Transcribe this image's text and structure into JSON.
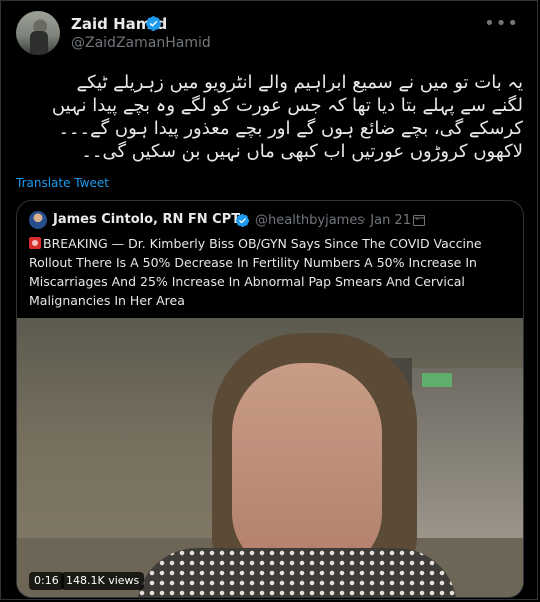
{
  "tweet": {
    "author_name": "Zaid Hamid",
    "author_handle": "@ZaidZamanHamid",
    "more_icon": "ellipsis-icon",
    "verified_color": "#1d9bf0",
    "text_lines": [
      "یہ بات تو میں نے سمیع ابراہیم والے انٹرویو میں زہریلے ٹیکے",
      "لگنے سے پہلے بتا دیا تھا کہ جس عورت کو لگے وہ بچے پیدا نہیں",
      "کرسکے گی، بچے ضائع ہوں گے اور بچے معذور پیدا ہوں گے۔۔۔",
      "لاکھوں کروڑوں عورتیں اب کبھی ماں نہیں بن سکیں گی۔۔"
    ],
    "translate_label": "Translate Tweet"
  },
  "quote": {
    "author_name": "James Cintolo, RN FN CPT",
    "author_handle": "@healthbyjames",
    "date": "· Jan 21 ·",
    "text": "BREAKING — Dr. Kimberly Biss OB/GYN Says Since The COVID Vaccine Rollout There Is A 50% Decrease In Fertility Numbers A 50% Increase In Miscarriages And 25% Increase In Abnormal Pap Smears And Cervical Malignancies In Her Area",
    "video": {
      "timestamp": "0:16",
      "views": "148.1K views"
    }
  },
  "colors": {
    "background": "#000000",
    "text": "#e7e9ea",
    "muted": "#71767b",
    "link": "#1d9bf0"
  }
}
